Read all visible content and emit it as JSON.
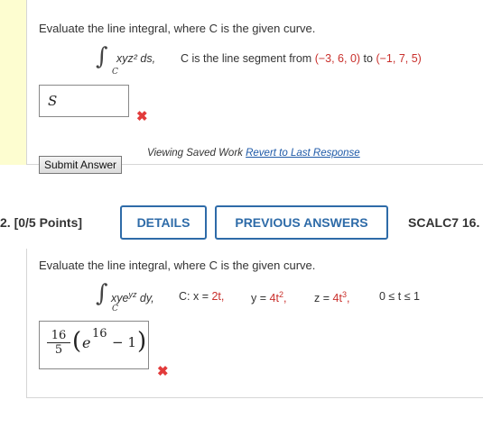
{
  "problem1": {
    "prompt": "Evaluate the line integral, where C is the given curve.",
    "integrand": "xyz² ds,",
    "curve_desc_prefix": "C is the line segment from",
    "point_from": "(−3, 6, 0)",
    "to_word": "to",
    "point_to": "(−1, 7, 5)",
    "sub_c": "C",
    "answer_value": "S",
    "submit_label": "Submit Answer",
    "viewing_text": "Viewing Saved Work",
    "revert_link": "Revert to Last Response",
    "colors": {
      "sidebar": "#fdfdd0",
      "wrong_mark": "#e23b3b",
      "link": "#1f5aa8"
    }
  },
  "problem2": {
    "number_points": "2.  [0/5 Points]",
    "details_label": "DETAILS",
    "previous_label": "PREVIOUS ANSWERS",
    "course_label": "SCALC7 16.",
    "prompt": "Evaluate the line integral, where C is the given curve.",
    "integrand": "xye",
    "integrand_exp": "yz",
    "integrand_tail": " dy,",
    "sub_c": "C",
    "c_x_prefix": "C: x = ",
    "c_x_val": "2t,",
    "c_y_prefix": "y = ",
    "c_y_val": "4t",
    "c_y_exp": "2",
    "c_z_prefix": "z = ",
    "c_z_val": "4t",
    "c_z_exp": "3",
    "t_range": "0 ≤ t ≤ 1",
    "answer_num": "16",
    "answer_den": "5",
    "answer_e": "e",
    "answer_exp": "16",
    "answer_rest": "− 1",
    "colors": {
      "tab_border": "#2e6ba8",
      "wrong_mark": "#e23b3b"
    }
  },
  "icons": {
    "wrong": "x-mark-icon"
  }
}
